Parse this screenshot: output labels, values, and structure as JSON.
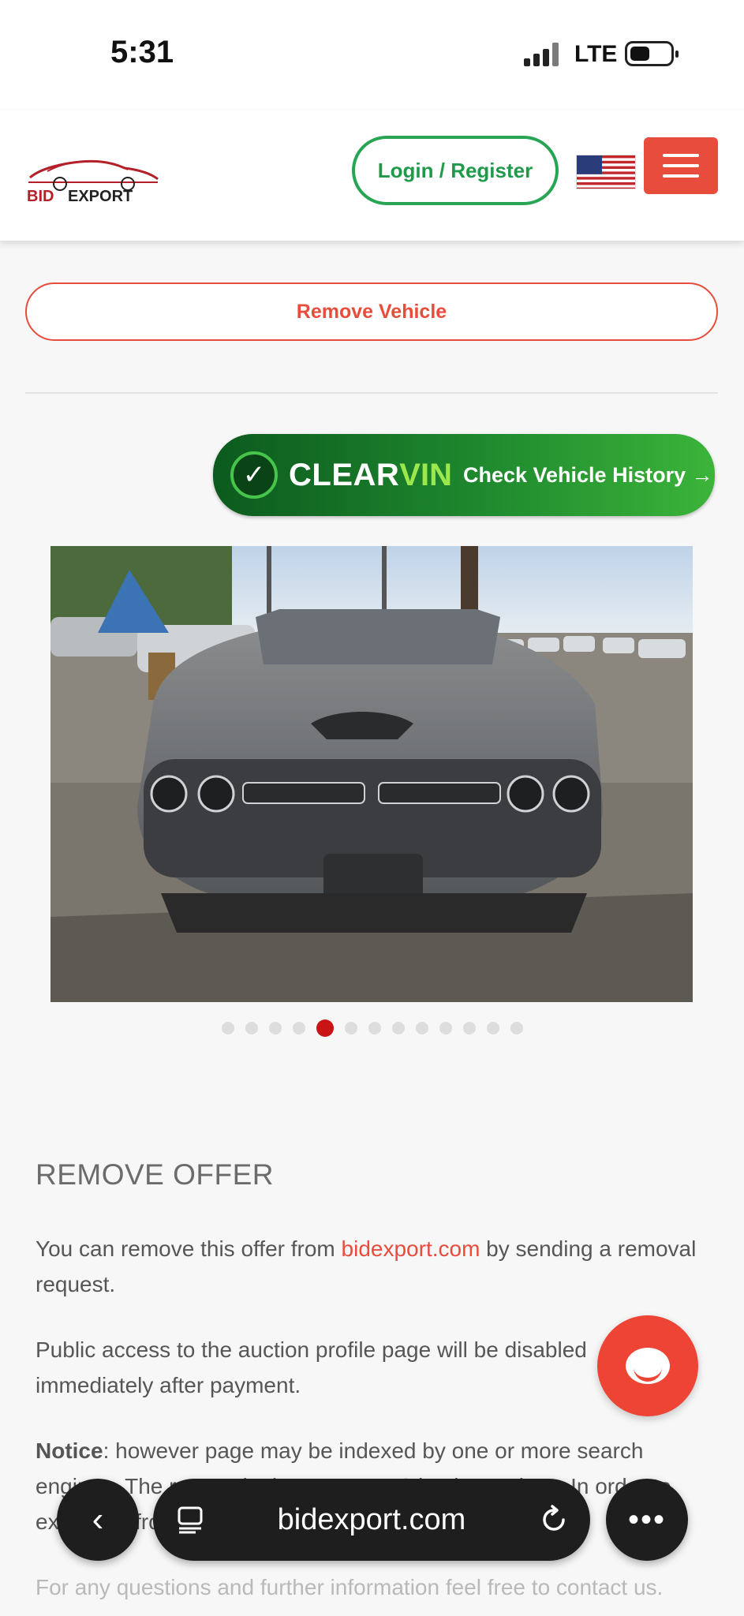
{
  "status_bar": {
    "time": "5:31",
    "network": "LTE"
  },
  "header": {
    "logo_text": "BID EXPORT",
    "login_label": "Login / Register",
    "flag_icon": "us-flag-icon",
    "menu_icon": "hamburger-icon",
    "brand_color": "#e74c3c",
    "login_color": "#27a454"
  },
  "actions": {
    "remove_vehicle_label": "Remove Vehicle"
  },
  "clearvin": {
    "clear": "CLEAR",
    "vin": "VIN",
    "tagline": "Check Vehicle History →"
  },
  "gallery": {
    "total_photos": 13,
    "active_index": 4,
    "photo": "car-front-photo"
  },
  "content": {
    "title": "REMOVE OFFER",
    "para1_before": "You can remove this offer from ",
    "para1_link": "bidexport.com",
    "para1_after": " by sending a removal request.",
    "para2": "Public access to the auction profile page will be disabled immediately after payment.",
    "notice_label": "Notice",
    "notice_text": ": however page may be indexed by one or more search engines. The removal takes up to 5-10 business days. In order to exclude it from their search results.",
    "para4": "For any questions and further information feel free to contact us."
  },
  "browser": {
    "url": "bidexport.com",
    "back_icon": "chevron-left-icon",
    "tabs_icon": "tabs-icon",
    "reload_icon": "reload-icon",
    "more_icon": "more-icon"
  }
}
